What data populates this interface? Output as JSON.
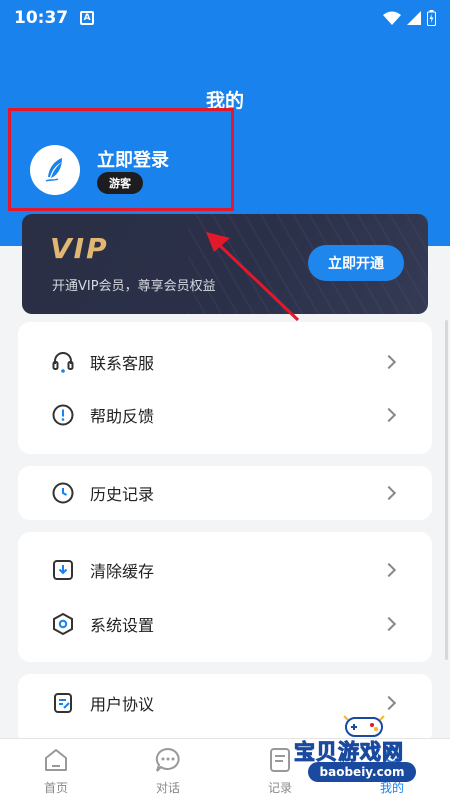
{
  "status_bar": {
    "time": "10:37",
    "notification_letter": "A"
  },
  "header": {
    "title": "我的"
  },
  "profile": {
    "login_label": "立即登录",
    "badge": "游客"
  },
  "vip": {
    "logo": "VIP",
    "subtitle": "开通VIP会员，尊享会员权益",
    "button": "立即开通"
  },
  "menu": {
    "contact": "联系客服",
    "feedback": "帮助反馈",
    "history": "历史记录",
    "clear_cache": "清除缓存",
    "settings": "系统设置",
    "user_agreement": "用户协议"
  },
  "tabbar": {
    "home": "首页",
    "chat": "对话",
    "records": "记录",
    "mine": "我的"
  },
  "watermark": {
    "name": "宝贝游戏网",
    "url": "baobeiy.com"
  },
  "colors": {
    "primary": "#1a82ec",
    "highlight_box": "#e3182a",
    "vip_gold": "#e2b774",
    "vip_card": "#2b3049"
  }
}
